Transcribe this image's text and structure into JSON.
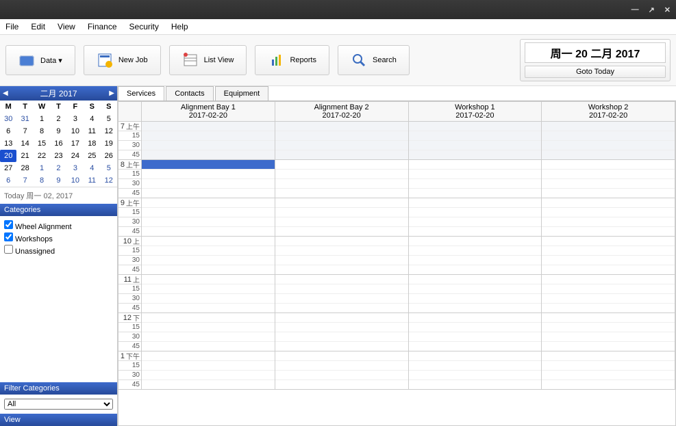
{
  "window": {
    "minimize": "—",
    "maximize": "↗",
    "close": "✕"
  },
  "menu": {
    "file": "File",
    "edit": "Edit",
    "view": "View",
    "finance": "Finance",
    "security": "Security",
    "help": "Help"
  },
  "toolbar": {
    "data": "Data ▾",
    "newjob": "New Job",
    "listview": "List View",
    "reports": "Reports",
    "search": "Search",
    "datebox": "周一 20 二月 2017",
    "goto": "Goto Today"
  },
  "calendar": {
    "title": "二月 2017",
    "dow": [
      "M",
      "T",
      "W",
      "T",
      "F",
      "S",
      "S"
    ],
    "rows": [
      [
        {
          "d": "30",
          "o": true
        },
        {
          "d": "31",
          "o": true
        },
        {
          "d": "1"
        },
        {
          "d": "2"
        },
        {
          "d": "3"
        },
        {
          "d": "4"
        },
        {
          "d": "5"
        }
      ],
      [
        {
          "d": "6"
        },
        {
          "d": "7"
        },
        {
          "d": "8"
        },
        {
          "d": "9"
        },
        {
          "d": "10"
        },
        {
          "d": "11"
        },
        {
          "d": "12"
        }
      ],
      [
        {
          "d": "13"
        },
        {
          "d": "14"
        },
        {
          "d": "15"
        },
        {
          "d": "16"
        },
        {
          "d": "17"
        },
        {
          "d": "18"
        },
        {
          "d": "19"
        }
      ],
      [
        {
          "d": "20",
          "t": true
        },
        {
          "d": "21"
        },
        {
          "d": "22"
        },
        {
          "d": "23"
        },
        {
          "d": "24"
        },
        {
          "d": "25"
        },
        {
          "d": "26"
        }
      ],
      [
        {
          "d": "27"
        },
        {
          "d": "28"
        },
        {
          "d": "1",
          "o": true
        },
        {
          "d": "2",
          "o": true
        },
        {
          "d": "3",
          "o": true
        },
        {
          "d": "4",
          "o": true
        },
        {
          "d": "5",
          "o": true
        }
      ],
      [
        {
          "d": "6",
          "o": true
        },
        {
          "d": "7",
          "o": true
        },
        {
          "d": "8",
          "o": true
        },
        {
          "d": "9",
          "o": true
        },
        {
          "d": "10",
          "o": true
        },
        {
          "d": "11",
          "o": true
        },
        {
          "d": "12",
          "o": true
        }
      ]
    ],
    "today_label": "Today 周一 02, 2017"
  },
  "categories": {
    "header": "Categories",
    "items": [
      {
        "label": "Wheel Alignment",
        "checked": true
      },
      {
        "label": "Workshops",
        "checked": true
      },
      {
        "label": "Unassigned",
        "checked": false
      }
    ]
  },
  "filter": {
    "header": "Filter Categories",
    "options": [
      "All"
    ],
    "selected": "All"
  },
  "view": {
    "header": "View"
  },
  "tabs": {
    "services": "Services",
    "contacts": "Contacts",
    "equipment": "Equipment"
  },
  "columns": [
    {
      "name": "Alignment Bay 1",
      "date": "2017-02-20"
    },
    {
      "name": "Alignment Bay 2",
      "date": "2017-02-20"
    },
    {
      "name": "Workshop 1",
      "date": "2017-02-20"
    },
    {
      "name": "Workshop 2",
      "date": "2017-02-20"
    }
  ],
  "timeslots": [
    {
      "h": "7",
      "p": "上午",
      "sub": [
        "15",
        "30",
        "45"
      ],
      "off": true,
      "sel": false
    },
    {
      "h": "8",
      "p": "上午",
      "sub": [
        "15",
        "30",
        "45"
      ],
      "off": false,
      "sel": true
    },
    {
      "h": "9",
      "p": "上午",
      "sub": [
        "15",
        "30",
        "45"
      ],
      "off": false,
      "sel": false
    },
    {
      "h": "10",
      "p": "上",
      "sub": [
        "15",
        "30",
        "45"
      ],
      "off": false,
      "sel": false
    },
    {
      "h": "11",
      "p": "上",
      "sub": [
        "15",
        "30",
        "45"
      ],
      "off": false,
      "sel": false
    },
    {
      "h": "12",
      "p": "下",
      "sub": [
        "15",
        "30",
        "45"
      ],
      "off": false,
      "sel": false
    },
    {
      "h": "1",
      "p": "下午",
      "sub": [
        "15",
        "30",
        "45"
      ],
      "off": false,
      "sel": false
    }
  ]
}
